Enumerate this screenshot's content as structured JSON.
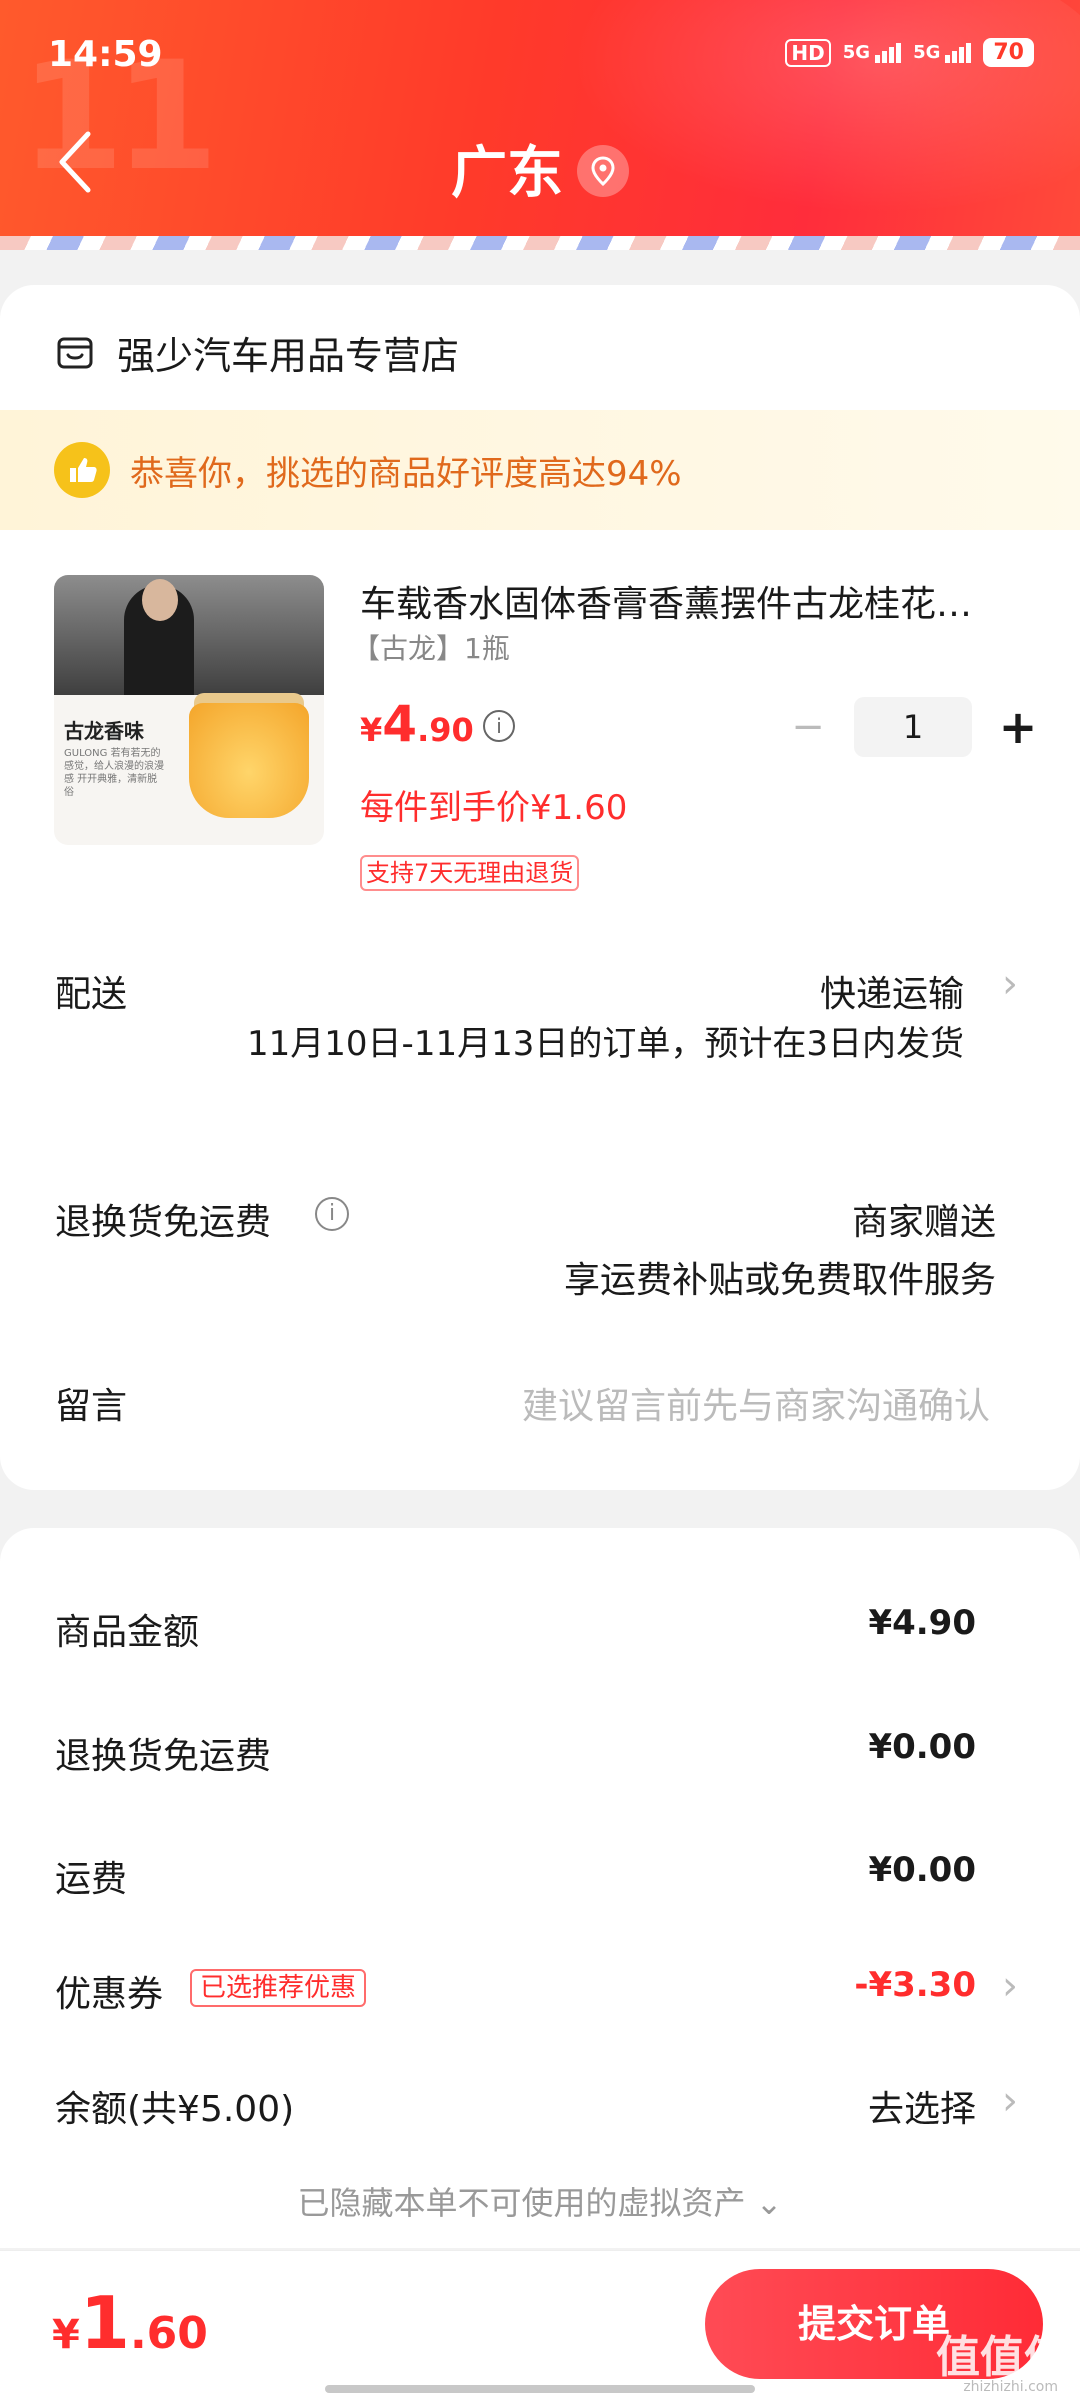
{
  "status_bar": {
    "time": "14:59",
    "hd": "HD",
    "net1": "5G",
    "net2": "5G",
    "battery": "70"
  },
  "header": {
    "title": "广东"
  },
  "shop": {
    "name": "强少汽车用品专营店"
  },
  "praise": {
    "text": "恭喜你，挑选的商品好评度高达94%"
  },
  "product": {
    "title": "车载香水固体香膏香薰摆件古龙桂花…",
    "spec": "【古龙】1瓶",
    "image_label": "古龙香味",
    "image_small": "GULONG 若有若无的感觉，给人浪漫的浪漫感 开开典雅，清新脱俗",
    "price_currency": "¥",
    "price_int": "4",
    "price_dec": ".90",
    "quantity": "1",
    "unit_price": "每件到手价¥1.60",
    "return_badge": "支持7天无理由退货"
  },
  "delivery": {
    "label": "配送",
    "value": "快递运输",
    "note": "11月10日-11月13日的订单，预计在3日内发货"
  },
  "return_freight": {
    "label": "退换货免运费",
    "value": "商家赠送",
    "note": "享运费补贴或免费取件服务"
  },
  "message": {
    "label": "留言",
    "placeholder": "建议留言前先与商家沟通确认"
  },
  "summary": {
    "goods_label": "商品金额",
    "goods_value": "¥4.90",
    "return_label": "退换货免运费",
    "return_value": "¥0.00",
    "freight_label": "运费",
    "freight_value": "¥0.00",
    "coupon_label": "优惠券",
    "coupon_tag": "已选推荐优惠",
    "coupon_value": "-¥3.30",
    "balance_label": "余额(共¥5.00)",
    "balance_value": "去选择",
    "hidden_note": "已隐藏本单不可使用的虚拟资产 ⌄"
  },
  "bottom": {
    "total_currency": "¥",
    "total_int": "1",
    "total_dec": ".60",
    "submit_label": "提交订单",
    "watermark": "值值值",
    "watermark_sub": "zhizhizhi.com"
  },
  "colors": {
    "accent": "#ff2d2d",
    "header": "#ff3a2a",
    "praise_text": "#e0691c"
  }
}
